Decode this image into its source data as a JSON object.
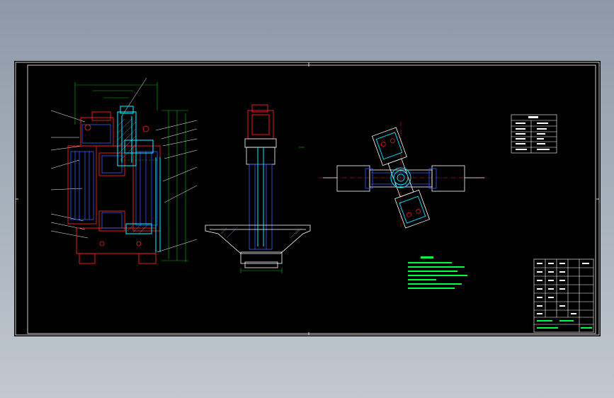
{
  "colors": {
    "background": "#000000",
    "workspace_bg": "#9aa5b1",
    "frame": "#ffffff",
    "geometry_red": "#ff2020",
    "geometry_blue": "#3a5cff",
    "geometry_cyan": "#00e5ff",
    "dimension_green": "#00d000",
    "notes_green": "#00ff40",
    "text_white": "#ffffff"
  },
  "drawing": {
    "views": [
      "front-section-view",
      "side-view",
      "top-view"
    ],
    "param_table": {
      "rows": 7,
      "cols": 2
    },
    "notes": {
      "lines": 8
    },
    "title_block": {
      "rows": 9
    }
  }
}
